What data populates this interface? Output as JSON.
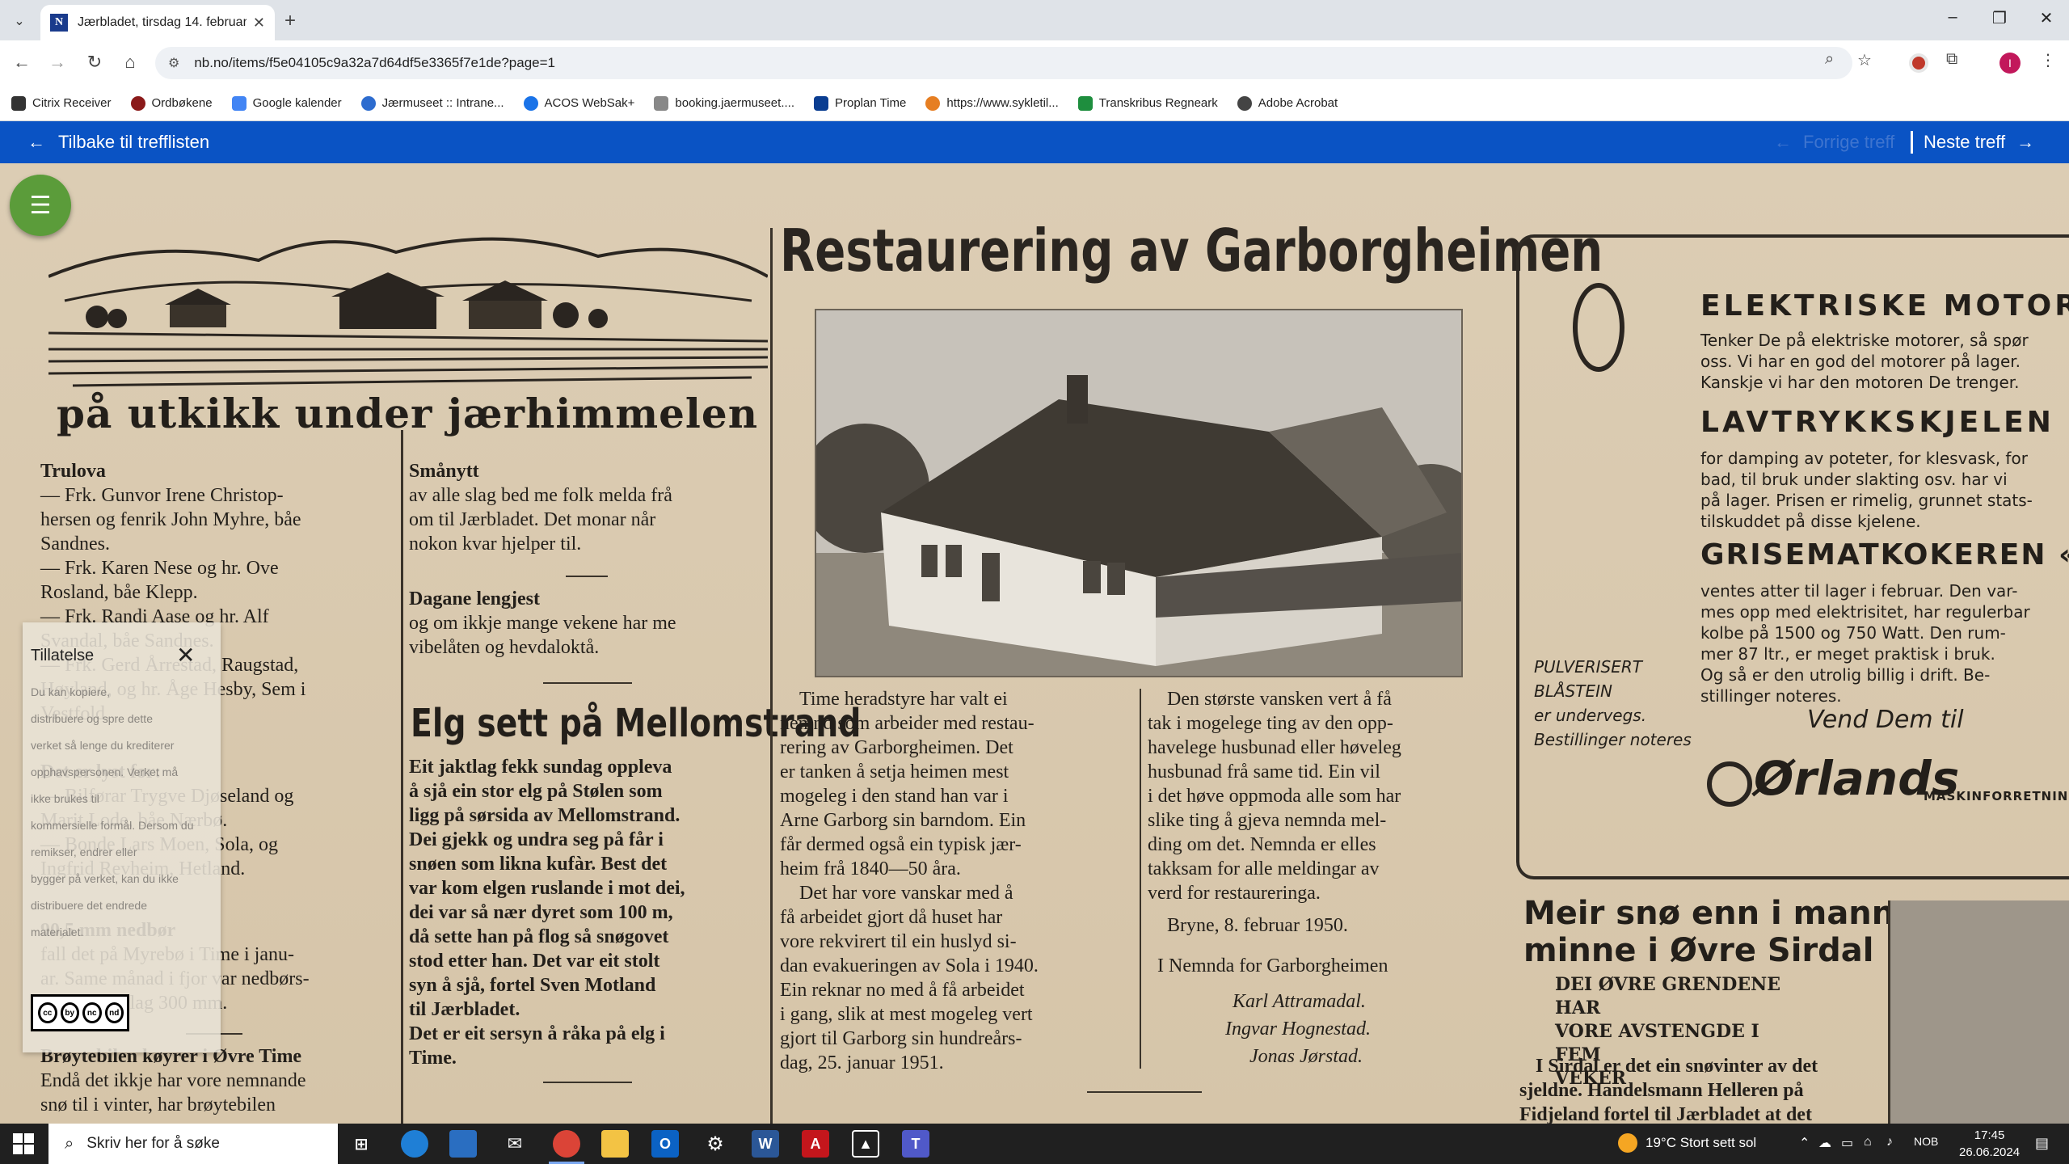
{
  "browser": {
    "tab_title": "Jærbladet, tirsdag 14. februar 1",
    "url": "nb.no/items/f5e04105c9a32a7d64df5e3365f7e1de?page=1",
    "bookmarks": [
      {
        "label": "Citrix Receiver",
        "color": "#333333"
      },
      {
        "label": "Ordbøkene",
        "color": "#8b1a1a"
      },
      {
        "label": "Google kalender",
        "color": "#4285f4"
      },
      {
        "label": "Jærmuseet :: Intrane...",
        "color": "#2d6ccf"
      },
      {
        "label": "ACOS WebSak+",
        "color": "#1a73e8"
      },
      {
        "label": "booking.jaermuseet....",
        "color": "#555555"
      },
      {
        "label": "Proplan Time",
        "color": "#0a3d91"
      },
      {
        "label": "https://www.sykletil...",
        "color": "#e67e22"
      },
      {
        "label": "Transkribus Regneark",
        "color": "#1e8e3e"
      },
      {
        "label": "Adobe Acrobat",
        "color": "#444444"
      }
    ]
  },
  "site": {
    "back_label": "Tilbake til trefflisten",
    "prev_label": "Forrige treff",
    "next_label": "Neste treff"
  },
  "newspaper": {
    "banner": "på utkikk under jærhimmelen",
    "trulova": {
      "heading": "Trulova",
      "lines": [
        "— Frk. Gunvor Irene Christop-",
        "hersen og fenrik John Myhre, båe",
        "Sandnes.",
        "— Frk. Karen Nese og hr. Ove",
        "Rosland, båe Klepp.",
        "— Frk. Randi Aase og hr. Alf",
        "Svandal, båe Sandnes.",
        "— Frk. Gerd Årrestad, Raugstad,",
        "Høyland, og hr. Åge Hesby, Sem i",
        "Vestfold."
      ]
    },
    "lyst": {
      "heading": "Det er lyst for:",
      "lines": [
        "— Bilførar Trygve Djøseland og",
        "Marit Lode, båe Nærbø.",
        "— Bonde Lars Moen, Sola, og",
        "Ingfrid Revheim, Hetland."
      ]
    },
    "nedbor": {
      "heading": "90,5 mm nedbør",
      "lines": [
        "fall det på Myrebø i Time i janu-",
        "ar. Same månad i fjor var nedbørs-",
        "mengda på lag 300 mm."
      ]
    },
    "broyte": {
      "heading": "Brøytebilen køyrer i Øvre Time",
      "lines": [
        "Endå det ikkje har vore nemnande",
        "snø til i vinter, har brøytebilen"
      ]
    },
    "smanytt": {
      "heading": "Smånytt",
      "lines": [
        "av alle slag bed me folk melda frå",
        "om til Jærbladet. Det monar når",
        "nokon kvar hjelper til."
      ]
    },
    "dagane": {
      "heading": "Dagane lengjest",
      "lines": [
        "og om ikkje mange vekene har me",
        "vibelåten og hevdaloktå."
      ]
    },
    "elg": {
      "heading": "Elg sett på Mellomstrand",
      "lines": [
        "Eit jaktlag fekk sundag oppleva",
        "å sjå ein stor elg på Stølen som",
        "ligg på sørsida av Mellomstrand.",
        "Dei gjekk og undra seg på får i",
        "snøen som likna kufàr. Best det",
        "var kom elgen ruslande i mot dei,",
        "dei var så nær dyret som 100 m,",
        "då sette han på flog så snøgovet",
        "stod etter han. Det var eit stolt",
        "syn å sjå, fortel Sven Motland",
        "til Jærbladet.",
        "Det er eit sersyn å råka på elg i",
        "Time."
      ]
    },
    "garborg": {
      "heading": "Restaurering av Garborgheimen",
      "left": [
        "Time heradstyre har valt ei",
        "nemnd som arbeider med restau-",
        "rering av Garborgheimen. Det",
        "er tanken å setja heimen mest",
        "mogeleg i den stand han var i",
        "Arne Garborg sin barndom. Ein",
        "får dermed også ein typisk jær-",
        "heim frå 1840—50 åra.",
        "Det har vore vanskar med å",
        "få arbeidet gjort då huset har",
        "vore rekvirert til ein huslyd si-",
        "dan evakueringen av Sola i 1940.",
        "Ein reknar no med å få arbeidet",
        "i gang, slik at mest mogeleg vert",
        "gjort til Garborg sin hundreårs-",
        "dag, 25. januar 1951."
      ],
      "right": [
        "Den største vansken vert å få",
        "tak i mogelege ting av den opp-",
        "havelege husbunad eller høveleg",
        "husbunad frå same tid. Ein vil",
        "i det høve oppmoda alle som har",
        "slike ting å gjeva nemnda mel-",
        "ding om det. Nemnda er elles",
        "takksam for alle meldingar av",
        "verd for restaureringa."
      ],
      "dateline": "Bryne, 8. februar 1950.",
      "committee": "I Nemnda for Garborgheimen",
      "signers": [
        "Karl Attramadal.",
        "Ingvar Hognestad.",
        "Jonas Jørstad."
      ]
    },
    "ad": {
      "title1": "ELEKTRISKE MOTORER",
      "text1": [
        "Tenker De på elektriske motorer, så spør",
        "oss. Vi har en god del motorer på lager.",
        "Kanskje vi har den motoren De trenger."
      ],
      "title2": "LAVTRYKKSKJELEN OSBY",
      "text2": [
        "for damping av poteter, for klesvask, for",
        "bad, til bruk under slakting osv. har vi",
        "på lager. Prisen er rimelig, grunnet stats-",
        "tilskuddet på disse kjelene."
      ],
      "title3": "GRISEMATKOKEREN «EFFEKT»",
      "text3": [
        "ventes atter til lager i februar. Den var-",
        "mes opp med elektrisitet, har regulerbar",
        "kolbe på 1500 og 750 Watt. Den rum-",
        "mer 87 ltr., er meget praktisk i bruk.",
        "Og så er den utrolig billig i drift. Be-",
        "stillinger noteres."
      ],
      "side": [
        "PULVERISERT",
        "BLÅSTEIN",
        "er undervegs.",
        "Bestillinger noteres"
      ],
      "vend": "Vend Dem til",
      "brand": "Ørlands",
      "brand_sub": "MASKINFORRETNING"
    },
    "snow": {
      "heading_lines": [
        "Meir snø enn i manns",
        "minne i Øvre Sirdal"
      ],
      "sub": [
        "DEI ØVRE GRENDENE HAR",
        "VORE AVSTENGDE I FEM",
        "VEKER"
      ],
      "lines": [
        "I Sirdal er det ein snøvinter av det",
        "sjeldne. Handelsmann Helleren på",
        "Fidjeland fortel til Jærbladet at det"
      ]
    }
  },
  "license": {
    "title": "Tillatelse",
    "text": [
      "Du kan kopiere,",
      "distribuere og spre dette",
      "verket så lenge du krediterer",
      "opphavspersonen. Verket må",
      "ikke brukes til",
      "kommersielle formål. Dersom du",
      "remikser, endrer eller",
      "bygger på verket, kan du ikke",
      "distribuere det endrede",
      "materialet."
    ],
    "badge": [
      "cc",
      "by",
      "nc",
      "nd"
    ]
  },
  "taskbar": {
    "search_placeholder": "Skriv her for å søke",
    "weather": "19°C Stort sett sol",
    "lang": "NOB",
    "time": "17:45",
    "date": "26.06.2024"
  }
}
